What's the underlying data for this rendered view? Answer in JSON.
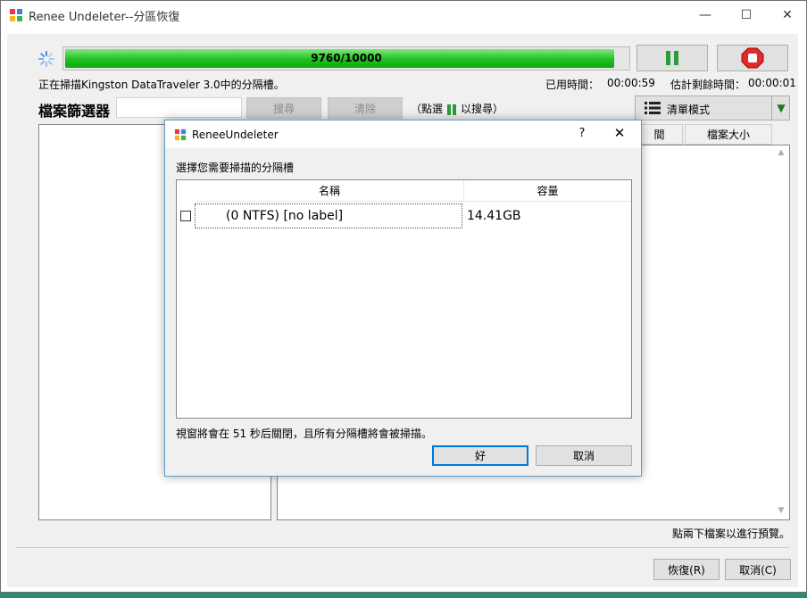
{
  "window": {
    "title": "Renee Undeleter--分區恢復",
    "minimize_glyph": "—",
    "maximize_glyph": "☐",
    "close_glyph": "✕"
  },
  "scan": {
    "progress_text": "9760/10000",
    "progress_fraction": 0.976,
    "status": "正在掃描Kingston DataTraveler 3.0中的分隔槽。",
    "elapsed_label": "已用時間：",
    "elapsed_value": "00:00:59",
    "remaining_label": "估計剩餘時間：",
    "remaining_value": "00:00:01",
    "pause_icon": "pause-icon",
    "stop_icon": "stop-icon",
    "accent_color": "#1fc01f"
  },
  "filter": {
    "label": "檔案篩選器",
    "search_button": "搜尋",
    "clear_button": "清除",
    "hint_prefix": "（點選",
    "hint_suffix": "以搜尋）",
    "mode_label": "清單模式"
  },
  "columns": {
    "partial_header": "間",
    "size_header": "檔案大小"
  },
  "preview_hint": "點兩下檔案以進行預覽。",
  "footer": {
    "recover_button": "恢復(R)",
    "cancel_button": "取消(C)"
  },
  "dialog": {
    "title": "ReneeUndeleter",
    "help_glyph": "?",
    "close_glyph": "✕",
    "prompt": "選擇您需要掃描的分隔槽",
    "columns": {
      "name": "名稱",
      "size": "容量"
    },
    "rows": [
      {
        "name": "(0 NTFS) [no label]",
        "size": "14.41GB",
        "checked": false
      }
    ],
    "footer_text": "視窗將會在 51 秒后關閉，且所有分隔槽將會被掃描。",
    "ok_button": "好",
    "cancel_button": "取消"
  }
}
